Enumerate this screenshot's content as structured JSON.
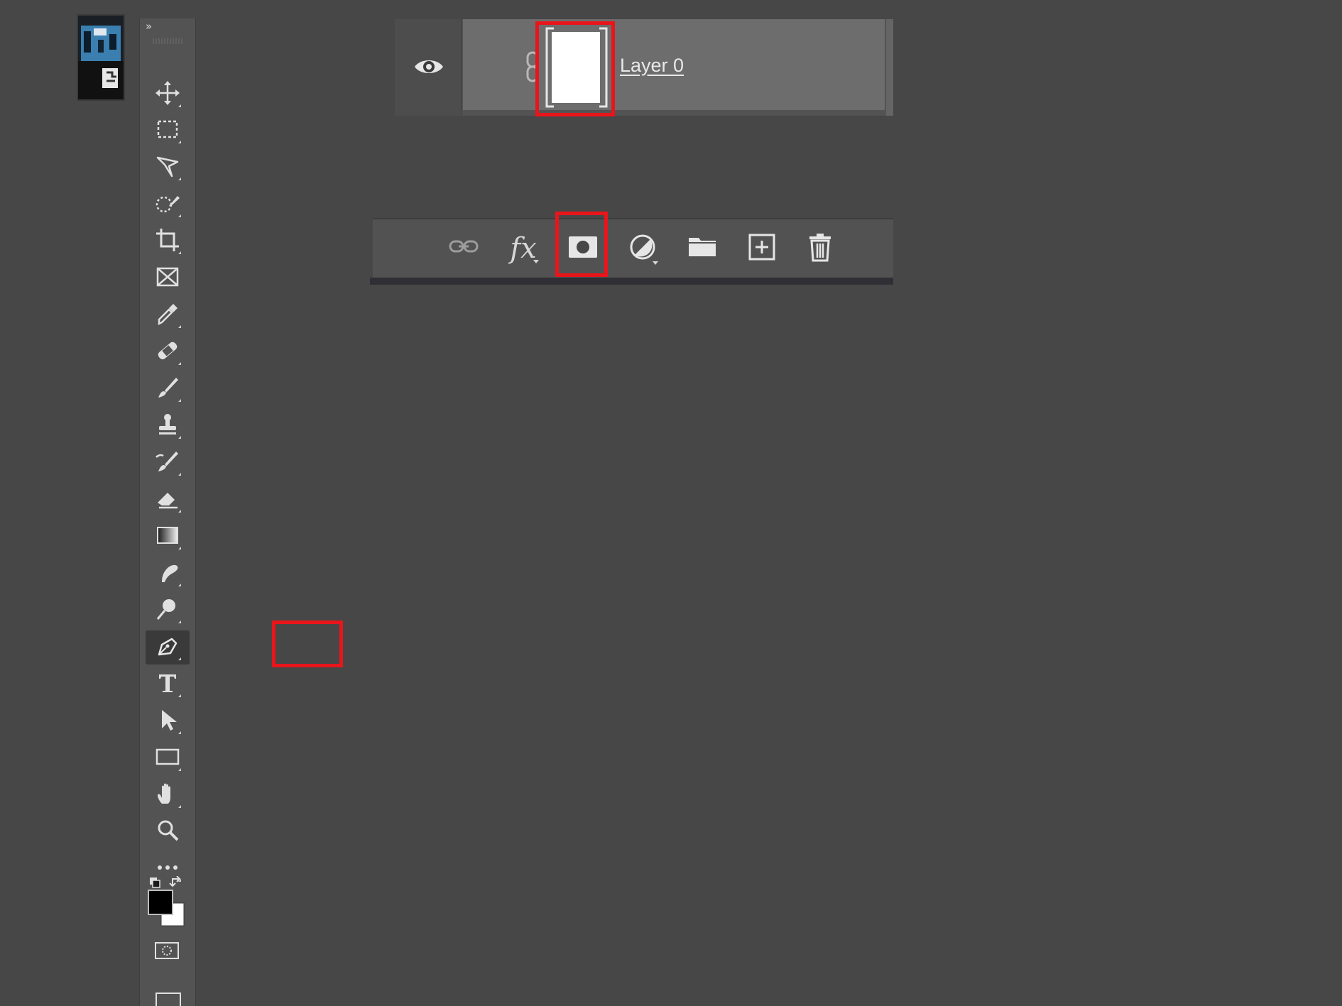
{
  "toolbar": {
    "collapse_label": "»",
    "tools": [
      {
        "name": "move-tool",
        "icon": "move-icon"
      },
      {
        "name": "rectangular-marquee-tool",
        "icon": "marquee-icon"
      },
      {
        "name": "lasso-tool",
        "icon": "polygonal-lasso-icon"
      },
      {
        "name": "quick-selection-tool",
        "icon": "quick-selection-icon"
      },
      {
        "name": "crop-tool",
        "icon": "crop-icon"
      },
      {
        "name": "frame-tool",
        "icon": "frame-icon"
      },
      {
        "name": "eyedropper-tool",
        "icon": "eyedropper-icon"
      },
      {
        "name": "healing-brush-tool",
        "icon": "bandage-icon"
      },
      {
        "name": "brush-tool",
        "icon": "brush-icon"
      },
      {
        "name": "clone-stamp-tool",
        "icon": "stamp-icon"
      },
      {
        "name": "history-brush-tool",
        "icon": "history-brush-icon"
      },
      {
        "name": "eraser-tool",
        "icon": "eraser-icon"
      },
      {
        "name": "gradient-tool",
        "icon": "gradient-icon"
      },
      {
        "name": "smudge-tool",
        "icon": "smudge-icon"
      },
      {
        "name": "dodge-tool",
        "icon": "dodge-icon"
      },
      {
        "name": "pen-tool",
        "icon": "pen-icon",
        "active": true,
        "highlighted": true
      },
      {
        "name": "type-tool",
        "icon": "type-icon"
      },
      {
        "name": "path-selection-tool",
        "icon": "arrow-icon"
      },
      {
        "name": "rectangle-tool",
        "icon": "rectangle-icon"
      },
      {
        "name": "hand-tool",
        "icon": "hand-icon"
      },
      {
        "name": "zoom-tool",
        "icon": "magnifier-icon"
      },
      {
        "name": "edit-toolbar",
        "icon": "more-icon"
      }
    ],
    "foreground_color": "#000000",
    "background_color": "#ffffff"
  },
  "layers": {
    "layer_name": "Layer 0",
    "visible": true,
    "mask_highlighted": true
  },
  "layer_bottom_bar": {
    "buttons": [
      {
        "name": "link-layers-button",
        "icon": "link-icon"
      },
      {
        "name": "add-layer-style-button",
        "icon": "fx-icon",
        "label": "fx"
      },
      {
        "name": "add-layer-mask-button",
        "icon": "mask-icon",
        "highlighted": true
      },
      {
        "name": "adjustment-layer-button",
        "icon": "half-circle-icon"
      },
      {
        "name": "new-group-button",
        "icon": "folder-icon"
      },
      {
        "name": "new-layer-button",
        "icon": "plus-square-icon"
      },
      {
        "name": "delete-layer-button",
        "icon": "trash-icon"
      }
    ]
  },
  "colors": {
    "highlight": "#e8151b",
    "panel": "#535353",
    "background": "#474747"
  }
}
